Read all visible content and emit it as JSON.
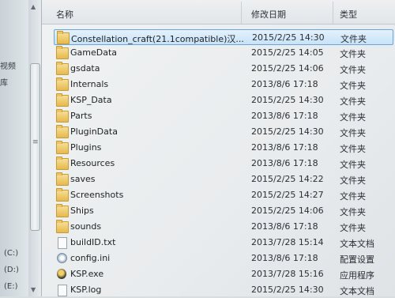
{
  "nav": {
    "labels": [
      "视频",
      "库",
      "(C:)",
      "(D:)",
      "(E:)"
    ]
  },
  "columns": {
    "name": "名称",
    "date": "修改日期",
    "type": "类型"
  },
  "files": [
    {
      "name": "Constellation_craft(21.1compatible)汉...",
      "date": "2015/2/25 14:30",
      "type": "文件夹",
      "icon": "folder-icon",
      "selected": true
    },
    {
      "name": "GameData",
      "date": "2015/2/25 14:05",
      "type": "文件夹",
      "icon": "folder-icon"
    },
    {
      "name": "gsdata",
      "date": "2015/2/25 14:06",
      "type": "文件夹",
      "icon": "folder-icon"
    },
    {
      "name": "Internals",
      "date": "2013/8/6 17:18",
      "type": "文件夹",
      "icon": "folder-icon"
    },
    {
      "name": "KSP_Data",
      "date": "2015/2/25 14:30",
      "type": "文件夹",
      "icon": "folder-icon"
    },
    {
      "name": "Parts",
      "date": "2013/8/6 17:18",
      "type": "文件夹",
      "icon": "folder-icon"
    },
    {
      "name": "PluginData",
      "date": "2015/2/25 14:30",
      "type": "文件夹",
      "icon": "folder-icon"
    },
    {
      "name": "Plugins",
      "date": "2013/8/6 17:18",
      "type": "文件夹",
      "icon": "folder-icon"
    },
    {
      "name": "Resources",
      "date": "2013/8/6 17:18",
      "type": "文件夹",
      "icon": "folder-icon"
    },
    {
      "name": "saves",
      "date": "2015/2/25 14:22",
      "type": "文件夹",
      "icon": "folder-icon"
    },
    {
      "name": "Screenshots",
      "date": "2015/2/25 14:27",
      "type": "文件夹",
      "icon": "folder-icon"
    },
    {
      "name": "Ships",
      "date": "2015/2/25 14:06",
      "type": "文件夹",
      "icon": "folder-icon"
    },
    {
      "name": "sounds",
      "date": "2013/8/6 17:18",
      "type": "文件夹",
      "icon": "folder-icon"
    },
    {
      "name": "buildID.txt",
      "date": "2013/7/28 15:14",
      "type": "文本文档",
      "icon": "text-file-icon"
    },
    {
      "name": "config.ini",
      "date": "2013/8/6 17:18",
      "type": "配置设置",
      "icon": "config-file-icon"
    },
    {
      "name": "KSP.exe",
      "date": "2013/7/28 15:16",
      "type": "应用程序",
      "icon": "application-icon"
    },
    {
      "name": "KSP.log",
      "date": "2015/2/25 14:30",
      "type": "文本文档",
      "icon": "text-file-icon"
    }
  ]
}
